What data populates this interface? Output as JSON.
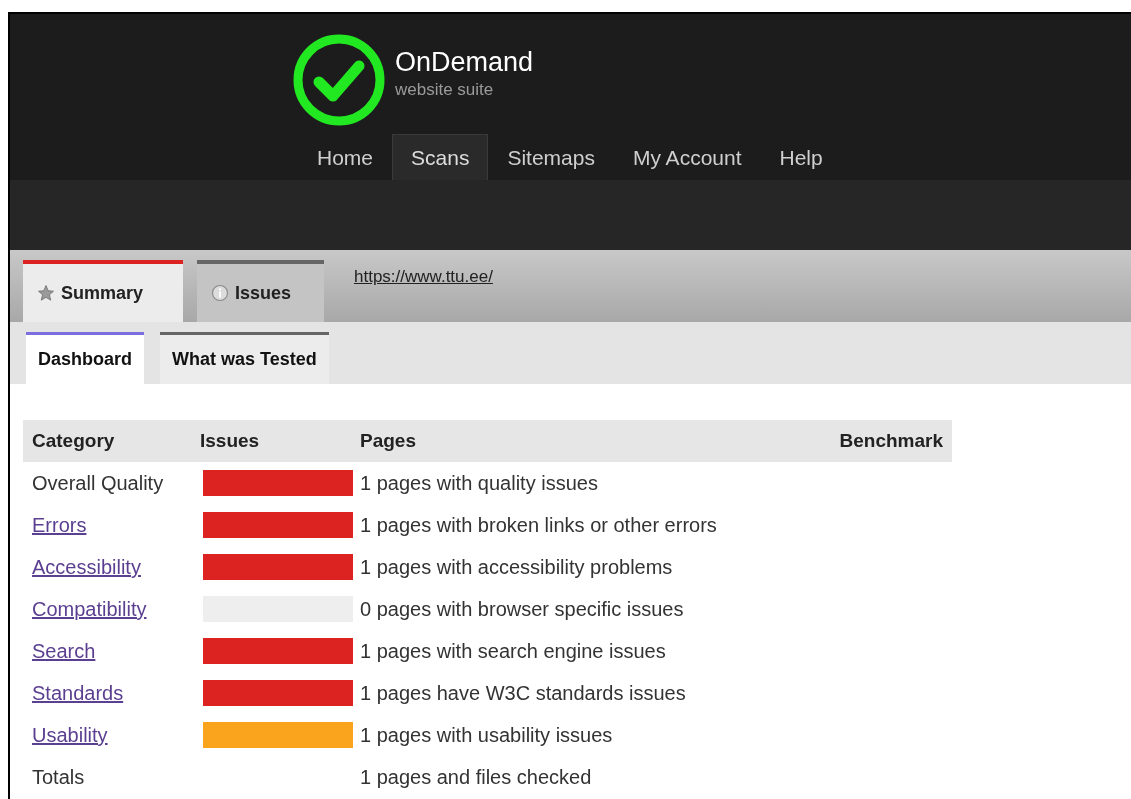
{
  "brand": {
    "title": "OnDemand",
    "subtitle": "website suite"
  },
  "nav": [
    {
      "label": "Home",
      "selected": false
    },
    {
      "label": "Scans",
      "selected": true
    },
    {
      "label": "Sitemaps",
      "selected": false
    },
    {
      "label": "My Account",
      "selected": false
    },
    {
      "label": "Help",
      "selected": false
    }
  ],
  "tabs": [
    {
      "label": "Summary",
      "kind": "star",
      "selected": true
    },
    {
      "label": "Issues",
      "kind": "info",
      "selected": false
    }
  ],
  "url": "https://www.ttu.ee/",
  "subtabs": [
    {
      "label": "Dashboard",
      "selected": true
    },
    {
      "label": "What was Tested",
      "selected": false
    }
  ],
  "table": {
    "columns": [
      "Category",
      "Issues",
      "Pages",
      "Benchmark"
    ],
    "rows": [
      {
        "category": "Overall Quality",
        "kind": "text",
        "color": "#dd2222",
        "pages": "1 pages with quality issues"
      },
      {
        "category": "Errors",
        "kind": "link",
        "color": "#dd2222",
        "pages": "1 pages with broken links or other errors"
      },
      {
        "category": "Accessibility",
        "kind": "link",
        "color": "#dd2222",
        "pages": "1 pages with accessibility problems"
      },
      {
        "category": "Compatibility",
        "kind": "link",
        "color": "#eeeeee",
        "pages": "0 pages with browser specific issues"
      },
      {
        "category": "Search",
        "kind": "link",
        "color": "#dd2222",
        "pages": "1 pages with search engine issues"
      },
      {
        "category": "Standards",
        "kind": "link",
        "color": "#dd2222",
        "pages": "1 pages have W3C standards issues"
      },
      {
        "category": "Usability",
        "kind": "link",
        "color": "#faa41e",
        "pages": "1 pages with usability issues"
      },
      {
        "category": "Totals",
        "kind": "text",
        "pages": "1 pages and files checked"
      }
    ]
  }
}
